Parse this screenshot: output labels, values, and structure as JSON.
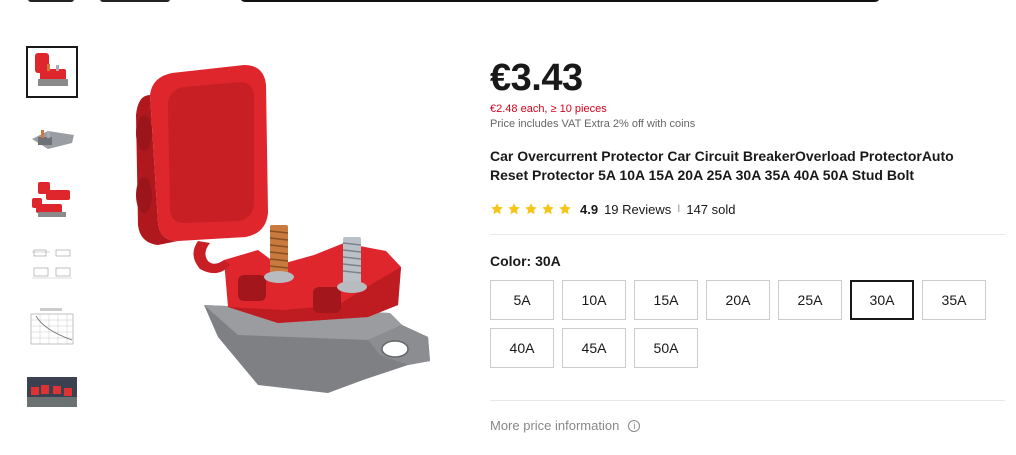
{
  "product": {
    "price": "€3.43",
    "bulk_price": "€2.48 each, ≥ 10 pieces",
    "vat_note": "Price includes VAT Extra 2% off with coins",
    "title": "Car Overcurrent Protector Car Circuit BreakerOverload ProtectorAuto Reset Protector 5A 10A 15A 20A 25A 30A 35A 40A 50A Stud Bolt",
    "rating": "4.9",
    "reviews": "19 Reviews",
    "separator": "I",
    "sold": "147 sold",
    "star_color": "#f5c518"
  },
  "variant": {
    "label": "Color: 30A",
    "options": [
      "5A",
      "10A",
      "15A",
      "20A",
      "25A",
      "30A",
      "35A",
      "40A",
      "45A",
      "50A"
    ],
    "selected": "30A"
  },
  "more_info": {
    "label": "More price information",
    "icon": "info-icon"
  },
  "thumbnails": [
    {
      "name": "thumb-red-breaker-open",
      "active": true
    },
    {
      "name": "thumb-gray-breaker"
    },
    {
      "name": "thumb-two-red-breakers"
    },
    {
      "name": "thumb-dimension-drawing"
    },
    {
      "name": "thumb-trip-curve-chart"
    },
    {
      "name": "thumb-installed-photo"
    }
  ],
  "colors": {
    "accent_red": "#d3031c",
    "product_red": "#e0262d",
    "product_gray": "#8a8a8a"
  }
}
